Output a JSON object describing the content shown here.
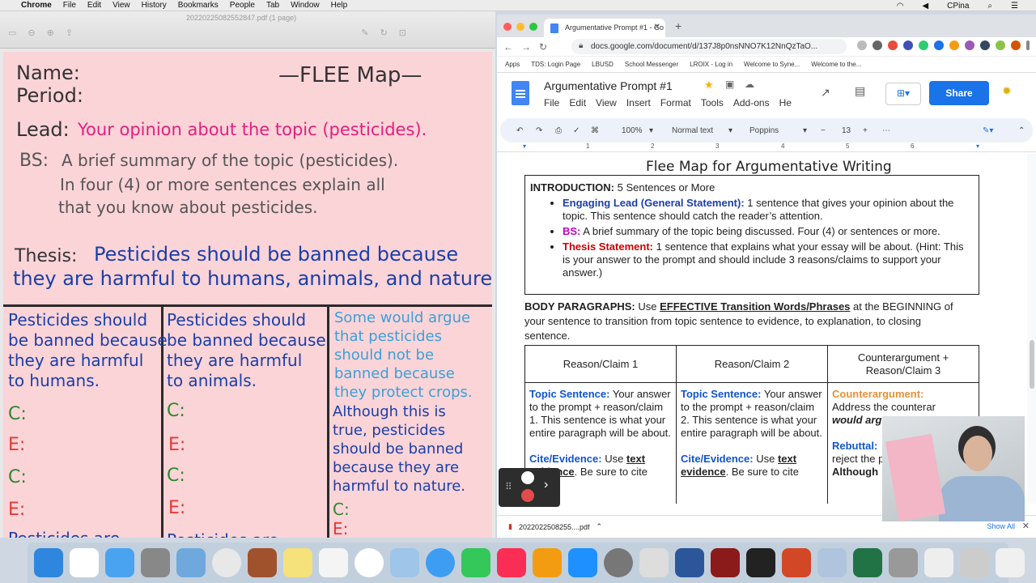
{
  "menubar": {
    "apple": "",
    "app": "Chrome",
    "items": [
      "File",
      "Edit",
      "View",
      "History",
      "Bookmarks",
      "People",
      "Tab",
      "Window",
      "Help"
    ],
    "user": "CPina"
  },
  "preview": {
    "title": "20220225082552847.pdf (1 page)"
  },
  "paper": {
    "name": "Name:",
    "period": "Period:",
    "flee": "—FLEE Map—",
    "lead_label": "Lead:",
    "lead_text": "Your opinion about the topic (pesticides).",
    "bs_label": "BS:",
    "bs_text1": "A brief summary of the topic (pesticides).",
    "bs_text2": "In four (4) or more sentences explain all",
    "bs_text3": "that you know about pesticides.",
    "thesis_label": "Thesis:",
    "thesis_text1": "Pesticides should be banned because",
    "thesis_text2": "they are harmful to humans, animals, and nature.",
    "col1": "Pesticides should\nbe banned because\nthey are harmful\nto humans.",
    "col2": "Pesticides should\nbe banned because\nthey are harmful\nto animals.",
    "col3a": "Some would argue\nthat pesticides\nshould not be\nbanned because\nthey protect crops.",
    "col3b": "Although this is\ntrue, pesticides\nshould be banned\nbecause they are\nharmful to nature.",
    "c": "C:",
    "e": "E:",
    "bottom1": "Pesticides are",
    "bottom2": "Pesticides are"
  },
  "browser": {
    "tab_title": "Argumentative Prompt #1 - Go",
    "url": "docs.google.com/document/d/137J8p0nsNNO7K12NnQzTaO...",
    "bookmarks": [
      "Apps",
      "TDS: Login Page",
      "LBUSD",
      "School Messenger",
      "LROIX - Log in",
      "Welcome to Syne...",
      "Welcome to the..."
    ]
  },
  "doc": {
    "title": "Argumentative Prompt #1",
    "menus": [
      "File",
      "Edit",
      "View",
      "Insert",
      "Format",
      "Tools",
      "Add-ons",
      "He"
    ],
    "share": "Share",
    "zoom": "100%",
    "style": "Normal text",
    "font": "Poppins",
    "size": "13",
    "ruler": [
      "1",
      "2",
      "3",
      "4",
      "5",
      "6"
    ],
    "heading": "Flee Map for Argumentative Writing",
    "intro_label": "INTRODUCTION:",
    "intro_text": "5 Sentences or More",
    "lead_label": "Engaging Lead (General Statement):",
    "lead_text": "1 sentence that gives your opinion about the topic. This sentence should catch the reader’s attention.",
    "bs_label": "BS:",
    "bs_text": "A brief summary of the topic being discussed. Four (4) or sentences or more.",
    "thesis_label": "Thesis Statement:",
    "thesis_text": "1 sentence that explains what your essay will be about. (Hint: This is your answer to the prompt and should include 3 reasons/claims to support your answer.)",
    "body_label": "BODY PARAGRAPHS:",
    "body_use": "Use",
    "body_link": "EFFECTIVE Transition Words/Phrases",
    "body_text": "at the BEGINNING of your sentence to transition from topic sentence to evidence, to explanation, to closing sentence.",
    "col_heads": [
      "Reason/Claim 1",
      "Reason/Claim 2",
      "Counterargument + Reason/Claim 3"
    ],
    "ts_label": "Topic Sentence:",
    "ts1": "Your answer to the prompt + reason/claim 1. This sentence is what your entire paragraph will be about.",
    "ts2": "Your answer to the prompt + reason/claim 2. This sentence is what your entire paragraph will be about.",
    "cite_label": "Cite/Evidence:",
    "cite_text": "Use",
    "cite_bold": "text evidence",
    "cite_end": ". Be sure to cite",
    "counter_label": "Counterargument:",
    "counter_text": "Address the counterar",
    "counter_italic": "would arg",
    "rebuttal_label": "Rebuttal:",
    "rebuttal_text": "reject the present re",
    "although": "Although"
  },
  "downloads": {
    "file": "2022022508255....pdf",
    "show_all": "Show All"
  }
}
